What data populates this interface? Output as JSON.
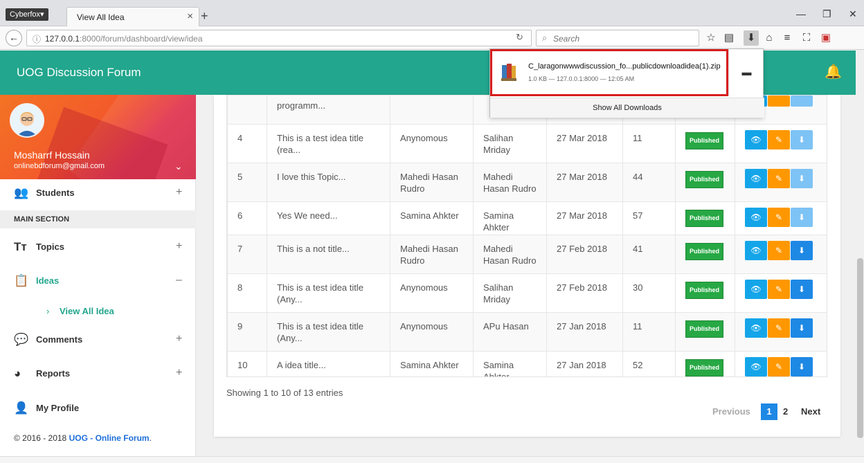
{
  "browser": {
    "brand": "Cyberfox▾",
    "tab_title": "View All Idea",
    "url_host": "127.0.0.1",
    "url_rest": ":8000/forum/dashboard/view/idea",
    "search_placeholder": "Search"
  },
  "app": {
    "title": "UOG Discussion Forum"
  },
  "profile": {
    "name": "Mosharrf Hossain",
    "email": "onlinebdforum@gmail.com"
  },
  "sidebar": {
    "students": "Students",
    "section_label": "MAIN SECTION",
    "topics": "Topics",
    "ideas": "Ideas",
    "view_all_idea": "View All Idea",
    "comments": "Comments",
    "reports": "Reports",
    "my_profile": "My Profile",
    "copyright_prefix": "© 2016 - 2018 ",
    "copyright_brand": "UOG - Online Forum",
    "copyright_suffix": "."
  },
  "table": {
    "partial_row_title": "programm...",
    "rows": [
      {
        "no": "4",
        "title": "This is a test idea title (rea...",
        "author": "Anynomous",
        "user": "Salihan Mriday",
        "date": "27 Mar 2018",
        "count": "11",
        "status": "Published"
      },
      {
        "no": "5",
        "title": "I love this Topic...",
        "author": "Mahedi Hasan Rudro",
        "user": "Mahedi Hasan Rudro",
        "date": "27 Mar 2018",
        "count": "44",
        "status": "Published"
      },
      {
        "no": "6",
        "title": "Yes We need...",
        "author": "Samina Ahkter",
        "user": "Samina Ahkter",
        "date": "27 Mar 2018",
        "count": "57",
        "status": "Published"
      },
      {
        "no": "7",
        "title": "This is a not title...",
        "author": "Mahedi Hasan Rudro",
        "user": "Mahedi Hasan Rudro",
        "date": "27 Feb 2018",
        "count": "41",
        "status": "Published"
      },
      {
        "no": "8",
        "title": "This is a test idea title (Any...",
        "author": "Anynomous",
        "user": "Salihan Mriday",
        "date": "27 Feb 2018",
        "count": "30",
        "status": "Published"
      },
      {
        "no": "9",
        "title": "This is a test idea title (Any...",
        "author": "Anynomous",
        "user": "APu Hasan",
        "date": "27 Jan 2018",
        "count": "11",
        "status": "Published"
      },
      {
        "no": "10",
        "title": "A idea title...",
        "author": "Samina Ahkter",
        "user": "Samina Ahkter",
        "date": "27 Jan 2018",
        "count": "52",
        "status": "Published"
      }
    ]
  },
  "pagination": {
    "showing": "Showing 1 to 10 of 13 entries",
    "previous": "Previous",
    "page1": "1",
    "page2": "2",
    "next": "Next"
  },
  "download": {
    "filename": "C_laragonwwwdiscussion_fo...publicdownloadidea(1).zip",
    "meta": "1.0 KB — 127.0.0.1:8000 — 12:05 AM",
    "show_all": "Show All Downloads"
  }
}
